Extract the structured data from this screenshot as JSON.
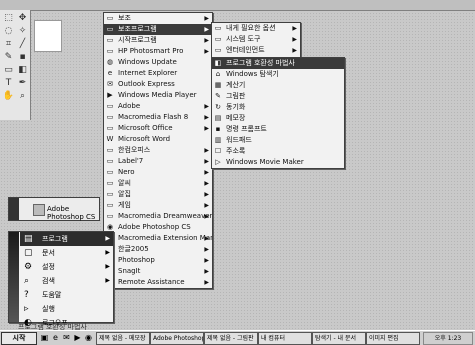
{
  "menu1": [
    {
      "label": "보조",
      "icon": "folder-icon",
      "sub": true
    },
    {
      "label": "보조프로그램",
      "icon": "folder-icon",
      "sub": true,
      "hl": true
    },
    {
      "label": "시작프로그램",
      "icon": "folder-icon",
      "sub": true
    },
    {
      "label": "HP Photosmart Pro",
      "icon": "folder-icon",
      "sub": true
    },
    {
      "label": "Windows Update",
      "icon": "globe-icon",
      "sub": false
    },
    {
      "label": "Internet Explorer",
      "icon": "ie-icon",
      "sub": false
    },
    {
      "label": "Outlook Express",
      "icon": "mail-icon",
      "sub": false
    },
    {
      "label": "Windows Media Player",
      "icon": "play-icon",
      "sub": false
    },
    {
      "label": "Adobe",
      "icon": "folder-icon",
      "sub": true
    },
    {
      "label": "Macromedia Flash 8",
      "icon": "folder-icon",
      "sub": true
    },
    {
      "label": "Microsoft Office",
      "icon": "folder-icon",
      "sub": true
    },
    {
      "label": "Microsoft Word",
      "icon": "word-icon",
      "sub": false
    },
    {
      "label": "한컴오피스",
      "icon": "folder-icon",
      "sub": true
    },
    {
      "label": "Label'7",
      "icon": "folder-icon",
      "sub": true
    },
    {
      "label": "Nero",
      "icon": "folder-icon",
      "sub": true
    },
    {
      "label": "알씨",
      "icon": "folder-icon",
      "sub": true
    },
    {
      "label": "알집",
      "icon": "folder-icon",
      "sub": true
    },
    {
      "label": "게임",
      "icon": "folder-icon",
      "sub": true
    },
    {
      "label": "Macromedia Dreamweaver 8",
      "icon": "folder-icon",
      "sub": true
    },
    {
      "label": "Adobe Photoshop CS",
      "icon": "photoshop-icon",
      "sub": false
    },
    {
      "label": "Macromedia Extension Manager",
      "icon": "folder-icon",
      "sub": true
    },
    {
      "label": "한글2005",
      "icon": "folder-icon",
      "sub": true
    },
    {
      "label": "Photoshop",
      "icon": "folder-icon",
      "sub": true
    },
    {
      "label": "SnagIt",
      "icon": "folder-icon",
      "sub": true
    },
    {
      "label": "Remote Assistance",
      "icon": "folder-icon",
      "sub": true
    }
  ],
  "menu2": [
    {
      "label": "내게 필요한 옵션",
      "icon": "folder-icon",
      "sub": true
    },
    {
      "label": "시스템 도구",
      "icon": "folder-icon",
      "sub": true
    },
    {
      "label": "엔터테인먼트",
      "icon": "folder-icon",
      "sub": true
    },
    {
      "label": "통신",
      "icon": "folder-icon",
      "sub": true
    }
  ],
  "menu3": [
    {
      "label": "프로그램 호환성 마법사",
      "icon": "app-icon",
      "hl": true
    },
    {
      "label": "Windows 탐색기",
      "icon": "explorer-icon"
    },
    {
      "label": "계산기",
      "icon": "calculator-icon"
    },
    {
      "label": "그림판",
      "icon": "paint-icon"
    },
    {
      "label": "동기화",
      "icon": "sync-icon"
    },
    {
      "label": "메모장",
      "icon": "notepad-icon"
    },
    {
      "label": "명령 프롬프트",
      "icon": "cmd-icon"
    },
    {
      "label": "워드패드",
      "icon": "wordpad-icon"
    },
    {
      "label": "주소록",
      "icon": "addressbook-icon"
    },
    {
      "label": "Windows Movie Maker",
      "icon": "movie-icon"
    }
  ],
  "app_panel": {
    "label": "Adobe Photoshop CS",
    "icon": "photoshop-icon"
  },
  "start_menu": [
    {
      "label": "프로그램",
      "icon": "programs-icon",
      "sub": true,
      "hl": true
    },
    {
      "label": "문서",
      "icon": "documents-icon",
      "sub": true
    },
    {
      "label": "설정",
      "icon": "settings-icon",
      "sub": true
    },
    {
      "label": "검색",
      "icon": "search-icon",
      "sub": true
    },
    {
      "label": "도움말",
      "icon": "help-icon",
      "sub": false
    },
    {
      "label": "실행",
      "icon": "run-icon",
      "sub": false
    },
    {
      "label": "로그오프",
      "icon": "logoff-icon",
      "sub": false
    },
    {
      "label": "시스템 종료",
      "icon": "shutdown-icon",
      "sub": false
    }
  ],
  "help_text": "프로그램 호환성 마법사",
  "taskbar": {
    "start_label": "시작",
    "tasks": [
      "제목 없음 - 메모장",
      "Adobe Photoshop",
      "제목 없음 - 그림판",
      "내 컴퓨터",
      "탐색기 - 내 문서",
      "이미지 편집"
    ],
    "clock": "오후 1:23"
  },
  "colors": {
    "highlight": "#3a3a3a",
    "menu_bg": "#f2f2f2",
    "desktop": "#c9c9c9"
  }
}
